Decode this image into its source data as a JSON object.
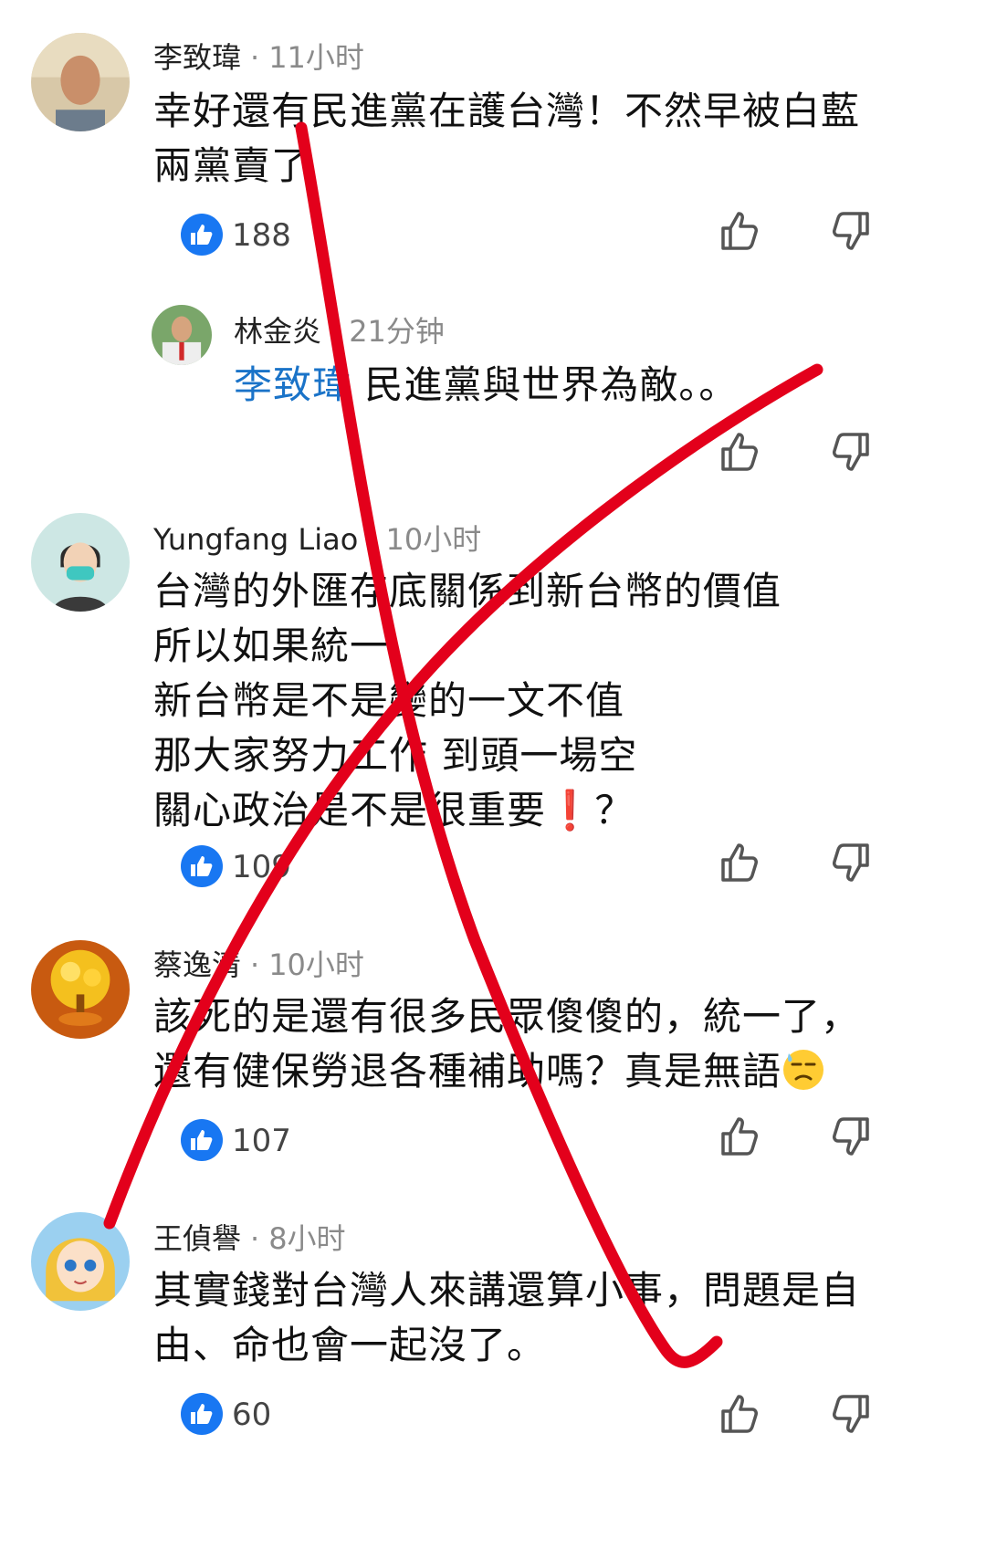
{
  "comments": [
    {
      "author": "李致瑋",
      "time": "11小时",
      "lines": [
        "幸好還有民進黨在護台灣！不然早被白藍",
        "兩黨賣了"
      ],
      "likes": "188"
    },
    {
      "author": "林金炎",
      "time": "21分钟",
      "mention": "李致瑋",
      "lines": [
        "民進黨與世界為敵。。"
      ]
    },
    {
      "author": "Yungfang Liao",
      "time": "10小时",
      "lines": [
        "台灣的外匯存底關係到新台幣的價值",
        "所以如果統一",
        "新台幣是不是變的一文不值",
        "那大家努力工作 到頭一場空",
        "關心政治是不是很重要"
      ],
      "line5_suffix_icon": "red-exclamation-emoji",
      "line5_end": "？",
      "likes": "109"
    },
    {
      "author": "蔡逸清",
      "time": "10小时",
      "lines": [
        "該死的是還有很多民眾傻傻的，統一了，",
        "還有健保勞退各種補助嗎？真是無語"
      ],
      "line2_suffix_icon": "downcast-sweat-emoji",
      "likes": "107"
    },
    {
      "author": "王偵譽",
      "time": "8小时",
      "lines": [
        "其實錢對台灣人來講還算小事，問題是自",
        "由、命也會一起沒了。"
      ],
      "likes": "60"
    }
  ],
  "colors": {
    "like_badge": "#1877f2",
    "mention": "#1a73c8",
    "overlay_x": "#e3001b"
  },
  "icons": [
    "thumbs-up-badge-icon",
    "thumbs-up-outline-icon",
    "thumbs-down-outline-icon"
  ]
}
